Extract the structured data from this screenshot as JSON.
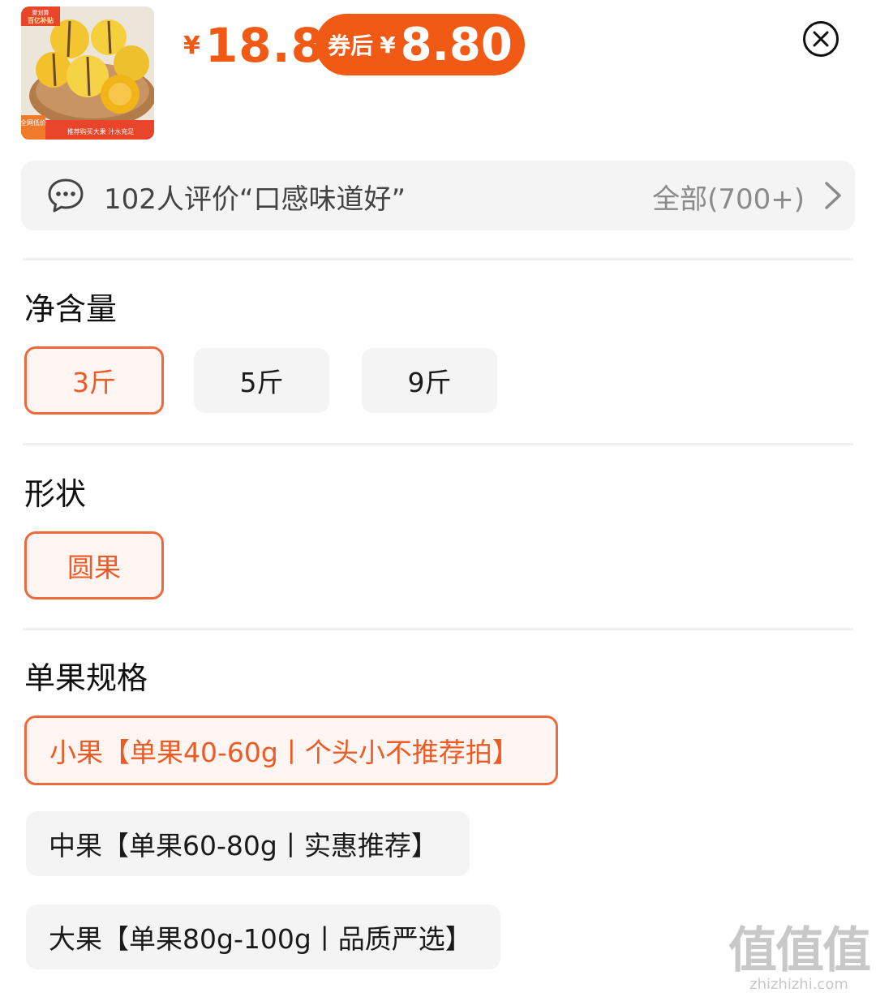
{
  "product": {
    "thumb": {
      "badge_top_small": "聚划算",
      "badge_top_big": "百亿补贴",
      "badge_bottom_left": "全网低价",
      "banner_text": "推荐购买大果 汁水充足"
    },
    "price": {
      "currency": "¥",
      "value": "18.8"
    },
    "coupon": {
      "label": "券后",
      "currency": "¥",
      "value": "8.80"
    }
  },
  "review": {
    "summary": "102人评价“口感味道好”",
    "all_label": "全部(700+)"
  },
  "sections": {
    "weight": {
      "title": "净含量",
      "options": [
        "3斤",
        "5斤",
        "9斤"
      ],
      "selected": "3斤"
    },
    "shape": {
      "title": "形状",
      "options": [
        "圆果"
      ],
      "selected": "圆果"
    },
    "size": {
      "title": "单果规格",
      "options": [
        "小果【单果40-60g丨个头小不推荐拍】",
        "中果【单果60-80g丨实惠推荐】",
        "大果【单果80g-100g丨品质严选】"
      ],
      "selected": "小果【单果40-60g丨个头小不推荐拍】"
    }
  },
  "watermark": {
    "big": "值值值",
    "small": "zhizhizhi.com"
  },
  "colors": {
    "accent": "#f05a14",
    "selected_border": "#ee6a3c",
    "option_bg": "#f4f4f4"
  },
  "icons": [
    "chat-bubble-icon",
    "chevron-right-icon",
    "close-circle-icon"
  ]
}
